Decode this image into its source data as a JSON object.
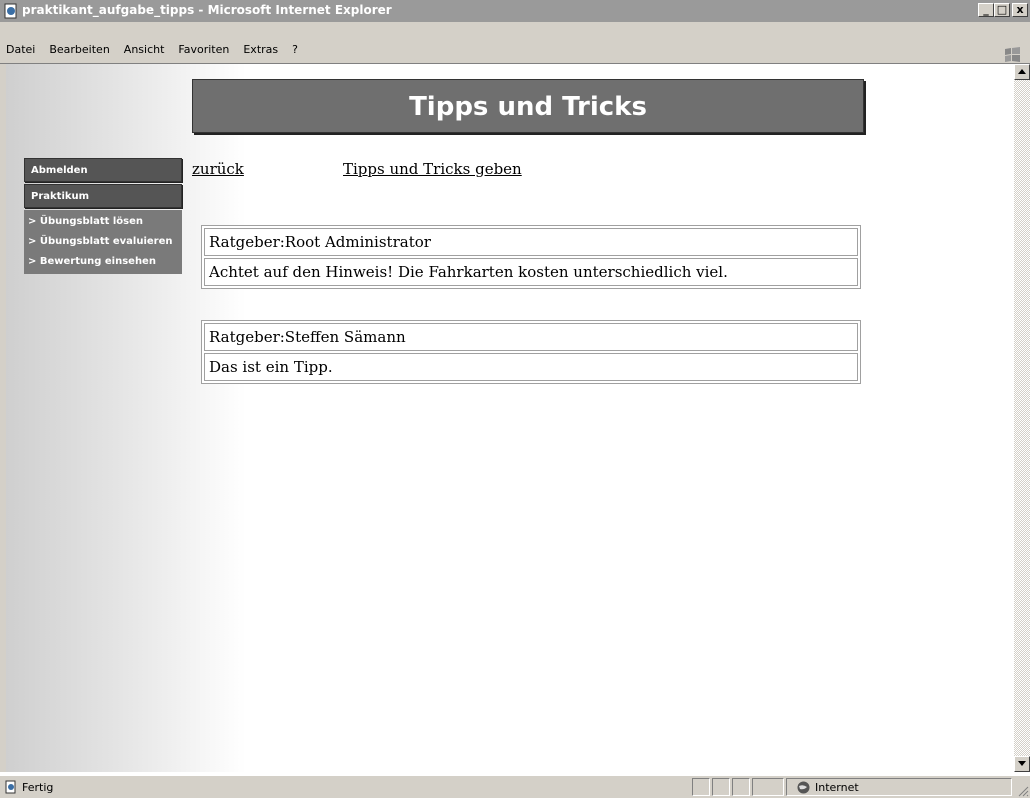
{
  "window": {
    "title": "praktikant_aufgabe_tipps - Microsoft Internet Explorer",
    "controls": [
      "_",
      "□",
      "x"
    ]
  },
  "menu": {
    "items": [
      {
        "label": "Datei"
      },
      {
        "label": "Bearbeiten"
      },
      {
        "label": "Ansicht"
      },
      {
        "label": "Favoriten"
      },
      {
        "label": "Extras"
      },
      {
        "label": "?"
      }
    ]
  },
  "page": {
    "banner_title": "Tipps und Tricks",
    "nav": {
      "logout": "Abmelden",
      "praktikum": "Praktikum",
      "links": [
        "> Übungsblatt lösen",
        "> Übungsblatt evaluieren",
        "> Bewertung einsehen"
      ]
    },
    "links": {
      "back": "zurück",
      "give_tips": "Tipps und Tricks geben"
    },
    "tips": [
      {
        "advisor": "Ratgeber:Root Administrator",
        "text": "Achtet auf den Hinweis! Die Fahrkarten kosten unterschiedlich viel."
      },
      {
        "advisor": "Ratgeber:Steffen Sämann",
        "text": "Das ist ein Tipp."
      }
    ]
  },
  "status": {
    "text": "Fertig",
    "zone": "Internet"
  },
  "icons": {
    "app": "ie-page-icon",
    "status": "document-icon",
    "zone": "globe-icon"
  }
}
